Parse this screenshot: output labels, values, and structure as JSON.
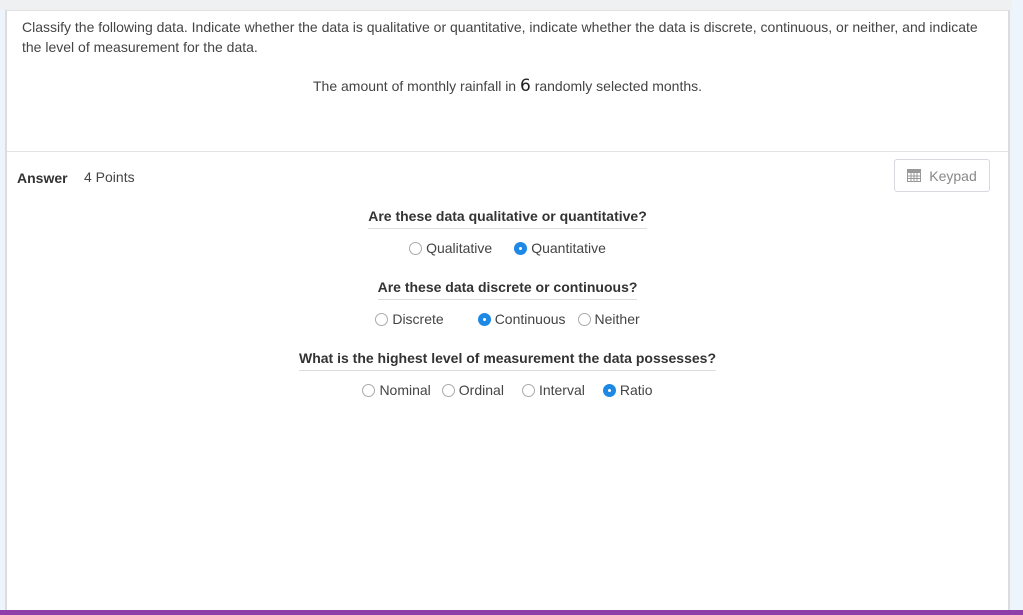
{
  "question": {
    "instructions": "Classify the following data. Indicate whether the data is qualitative or quantitative, indicate whether the data is discrete, continuous, or neither, and indicate the level of measurement for the data.",
    "prompt_before": "The amount of monthly rainfall in ",
    "prompt_number": "6",
    "prompt_after": " randomly selected months."
  },
  "answer": {
    "label": "Answer",
    "points": "4 Points",
    "keypad_label": "Keypad",
    "keypad_icon": "calculator-icon"
  },
  "groups": [
    {
      "title": "Are these data qualitative or quantitative?",
      "options": [
        {
          "label": "Qualitative",
          "selected": false
        },
        {
          "label": "Quantitative",
          "selected": true
        }
      ]
    },
    {
      "title": "Are these data discrete or continuous?",
      "options": [
        {
          "label": "Discrete",
          "selected": false
        },
        {
          "label": "Continuous",
          "selected": true
        },
        {
          "label": "Neither",
          "selected": false
        }
      ]
    },
    {
      "title": "What is the highest level of measurement the data possesses?",
      "options": [
        {
          "label": "Nominal",
          "selected": false
        },
        {
          "label": "Ordinal",
          "selected": false
        },
        {
          "label": "Interval",
          "selected": false
        },
        {
          "label": "Ratio",
          "selected": true
        }
      ]
    }
  ],
  "colors": {
    "accent": "#1e88e5",
    "bottom_bar": "#8e3fa8"
  }
}
